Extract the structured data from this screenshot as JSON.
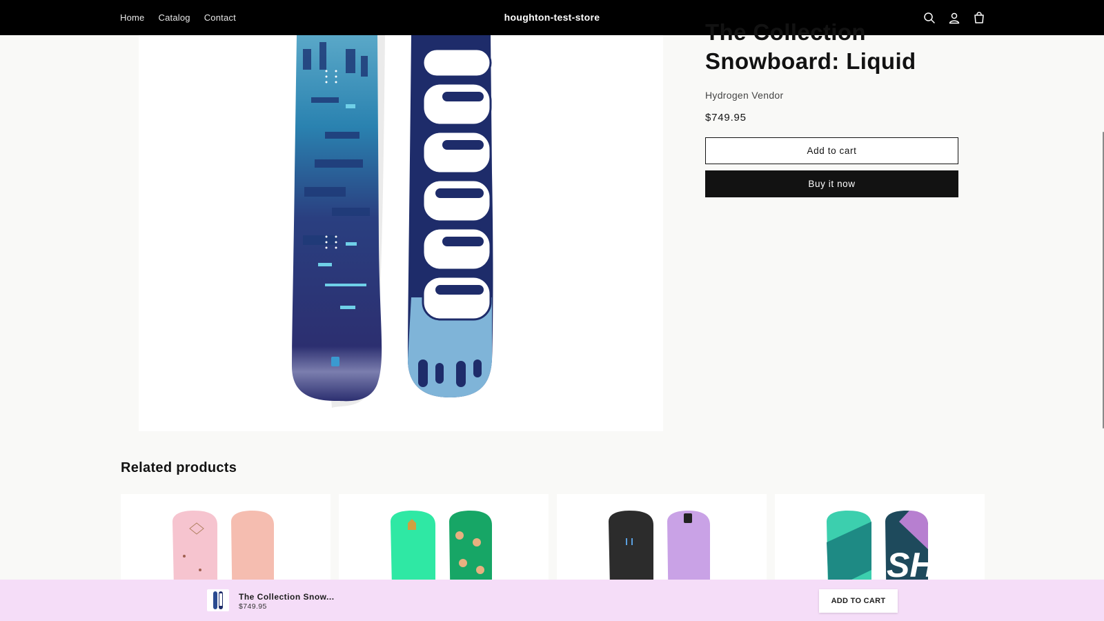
{
  "header": {
    "nav": [
      "Home",
      "Catalog",
      "Contact"
    ],
    "store_name": "houghton-test-store",
    "icons": [
      "search-icon",
      "account-icon",
      "cart-icon"
    ],
    "background": "#000000"
  },
  "product": {
    "title_line1": "The Collection",
    "title_line2": "Snowboard: Liquid",
    "vendor": "Hydrogen Vendor",
    "price": "$749.95",
    "add_to_cart_label": "Add to cart",
    "buy_now_label": "Buy it now"
  },
  "related": {
    "heading": "Related products",
    "items": [
      {
        "colors": [
          "#f4b8c8",
          "#f0c0a8"
        ],
        "accent": "#f6a8c4"
      },
      {
        "colors": [
          "#2fe0a0",
          "#1fa86a"
        ],
        "accent": "#1a9a5c"
      },
      {
        "colors": [
          "#2a2a2a",
          "#c8a0e8"
        ],
        "accent": "#b890e0"
      },
      {
        "colors": [
          "#3fd0b0",
          "#1e4a5a"
        ],
        "accent": "#c080d0"
      }
    ]
  },
  "sticky": {
    "name": "The Collection Snow...",
    "price": "$749.95",
    "button_label": "ADD TO CART",
    "background": "#f5ddf8"
  }
}
